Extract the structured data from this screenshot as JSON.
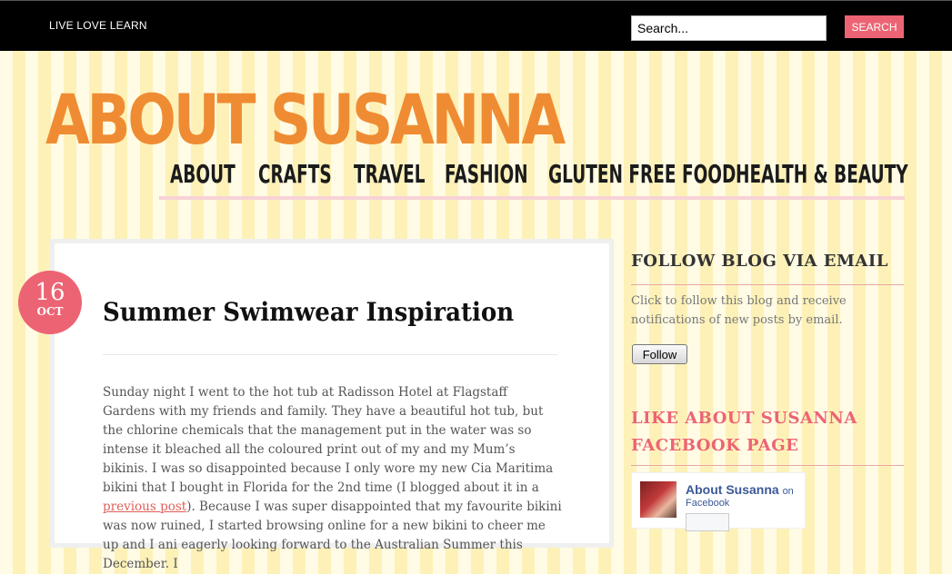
{
  "header": {
    "tagline": "LIVE LOVE LEARN",
    "search_placeholder": "Search...",
    "search_button": "SEARCH"
  },
  "site": {
    "title": "ABOUT SUSANNA"
  },
  "nav": [
    "ABOUT",
    "CRAFTS",
    "TRAVEL",
    "FASHION",
    "GLUTEN FREE FOOD",
    "HEALTH & BEAUTY"
  ],
  "post": {
    "date_day": "16",
    "date_month": "OCT",
    "title": "Summer Swimwear Inspiration",
    "body_before_link": "Sunday night I went to the hot tub at Radisson Hotel at Flagstaff Gardens with my friends and family. They have a beautiful hot tub, but the chlorine chemicals that the management put in the water was so intense it bleached all the coloured print out of my and my Mum’s bikinis. I was so disappointed because I only wore my new Cia Maritima bikini that I bought in Florida for the 2nd time (I blogged about it in a ",
    "body_link": "previous post",
    "body_after_link": "). Because I was super disappointed that my favourite bikini was now ruined, I started browsing online for a new bikini to cheer me up and I ani eagerly looking forward to the Australian Summer this December. I"
  },
  "sidebar": {
    "follow_title": "FOLLOW BLOG VIA EMAIL",
    "follow_text": "Click to follow this blog and receive notifications of new posts by email.",
    "follow_button": "Follow",
    "facebook_title": "LIKE ABOUT SUSANNA FACEBOOK PAGE",
    "facebook_name": "About Susanna",
    "facebook_on": "on",
    "facebook_sub": "Facebook"
  },
  "colors": {
    "accent_pink": "#ec6474",
    "title_orange": "#ef8c33",
    "stripe_yellow": "#fdf1b8"
  }
}
